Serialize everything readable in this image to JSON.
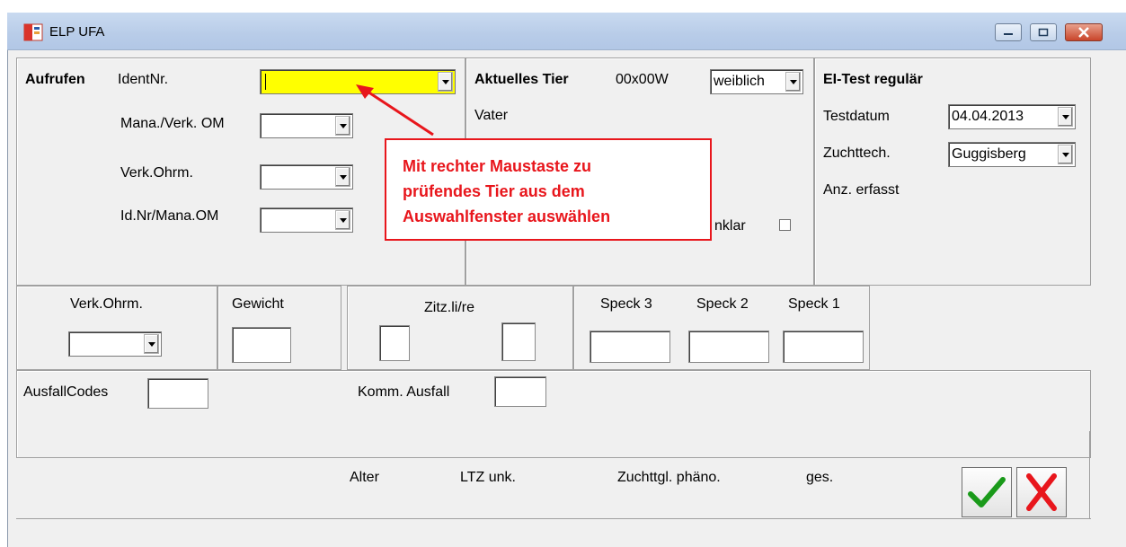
{
  "window": {
    "title": "ELP UFA"
  },
  "top_left": {
    "header": "Aufrufen",
    "identnr_label": "IdentNr.",
    "identnr_value": "",
    "mana_verk_label": "Mana./Verk. OM",
    "verk_ohrm_label": "Verk.Ohrm.",
    "idnr_mana_label": "Id.Nr/Mana.OM"
  },
  "top_middle": {
    "header": "Aktuelles Tier",
    "tier_id": "00x00W",
    "sex_value": "weiblich",
    "vater_label": "Vater",
    "unklar_label": "nklar"
  },
  "top_right": {
    "header": "EI-Test regulär",
    "testdatum_label": "Testdatum",
    "testdatum_value": "04.04.2013",
    "zuchttech_label": "Zuchttech.",
    "zuchttech_value": "Guggisberg",
    "anz_label": "Anz. erfasst"
  },
  "measure_row": {
    "verk_ohrm_label": "Verk.Ohrm.",
    "gewicht_label": "Gewicht",
    "zitz_label": "Zitz.li/re",
    "speck3_label": "Speck 3",
    "speck2_label": "Speck 2",
    "speck1_label": "Speck 1"
  },
  "ausfall_row": {
    "codes_label": "AusfallCodes",
    "komm_label": "Komm. Ausfall"
  },
  "bottom_row": {
    "alter_label": "Alter",
    "ltz_label": "LTZ unk.",
    "zuchttgl_label": "Zuchttgl. phäno.",
    "ges_label": "ges."
  },
  "callout": {
    "lines": [
      "Mit rechter Maustaste zu",
      "prüfendes Tier aus dem",
      "Auswahlfenster auswählen"
    ]
  },
  "colors": {
    "highlight_yellow": "#ffff00",
    "annotation_red": "#e8161c",
    "ok_green": "#1a9a1a",
    "cancel_red": "#e8161c"
  }
}
